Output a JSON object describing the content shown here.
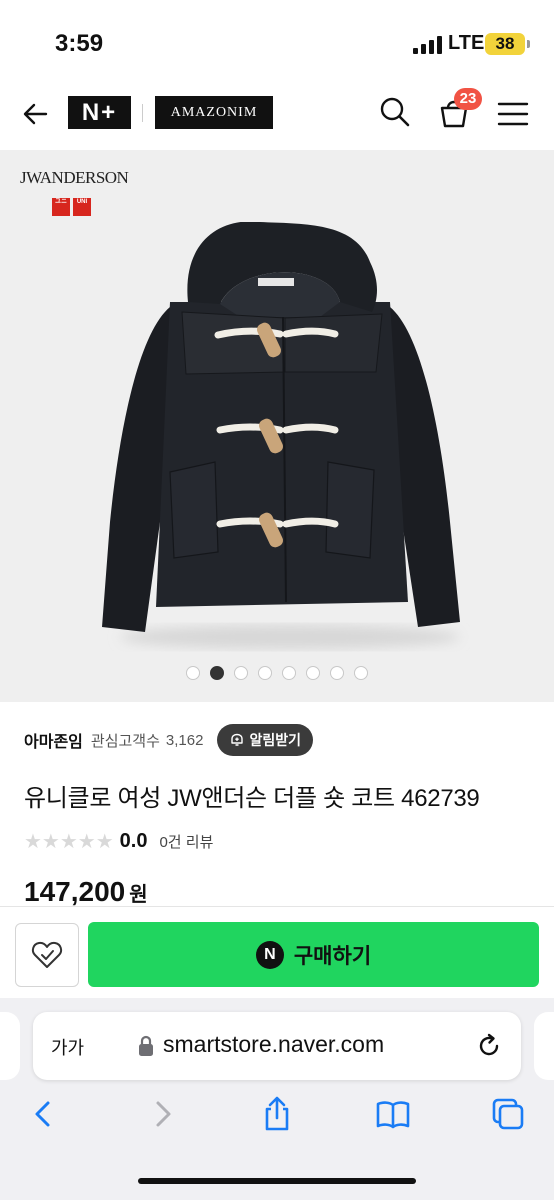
{
  "status_bar": {
    "time": "3:59",
    "network": "LTE",
    "battery": "38"
  },
  "header": {
    "nplus_logo": "N+",
    "store_logo": "AMAZONIM",
    "cart_count": "23"
  },
  "gallery": {
    "brand_text": "JWANDERSON",
    "uniqlo_letters": [
      "ユニ",
      "クロ",
      "UNI",
      "QLO"
    ],
    "dot_count": 8,
    "active_index": 1
  },
  "seller": {
    "name": "아마존임",
    "interest_label": "관심고객수",
    "interest_count": "3,162",
    "alert_label": "알림받기"
  },
  "product": {
    "title": "유니클로 여성 JW앤더슨 더플 숏 코트 462739",
    "rating_stars": "★★★★★",
    "rating_value": "0.0",
    "review_count": "0건 리뷰",
    "price": "147,200",
    "price_unit": "원"
  },
  "buy_bar": {
    "npay_mark": "N",
    "buy_label": "구매하기"
  },
  "browser": {
    "text_size_label": "가가",
    "url": "smartstore.naver.com"
  },
  "colors": {
    "buy_green": "#20d55f",
    "badge_red": "#f15344",
    "ios_blue": "#1a7cf5"
  }
}
